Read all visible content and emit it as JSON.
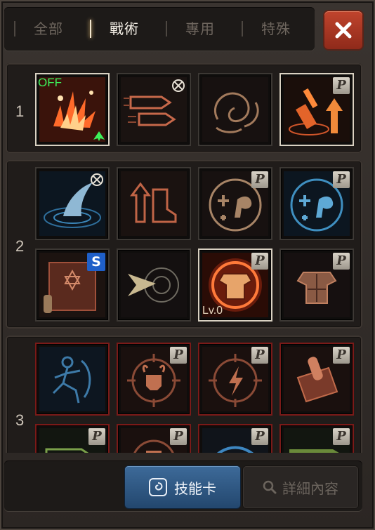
{
  "tabs": [
    {
      "label": "全部",
      "active": false
    },
    {
      "label": "戰術",
      "active": true
    },
    {
      "label": "專用",
      "active": false
    },
    {
      "label": "特殊",
      "active": false
    }
  ],
  "close_icon": "close-x-icon",
  "rows": [
    {
      "number": "1",
      "slots": [
        {
          "icon": "explosion-skill-icon",
          "overlay": "OFF",
          "badge": "upgrade-arrow",
          "selected": true
        },
        {
          "icon": "bullets-skill-icon",
          "badge": "locked"
        },
        {
          "icon": "smoke-swirl-skill-icon"
        },
        {
          "icon": "boost-flask-skill-icon",
          "badge": "P"
        }
      ]
    },
    {
      "number": "2",
      "slots": [
        {
          "icon": "shark-fin-skill-icon",
          "badge": "locked"
        },
        {
          "icon": "boot-up-skill-icon"
        },
        {
          "icon": "strength-plus-skill-icon",
          "badge": "P"
        },
        {
          "icon": "strength-plus-blue-skill-icon",
          "badge": "P"
        },
        {
          "icon": "hexagram-scroll-skill-icon",
          "badge": "S"
        },
        {
          "icon": "dash-crosshair-skill-icon"
        },
        {
          "icon": "armor-fire-skill-icon",
          "badge": "P",
          "level": "Lv.0",
          "selected": true
        },
        {
          "icon": "armor-skill-icon",
          "badge": "P"
        }
      ]
    },
    {
      "number": "3",
      "slots": [
        {
          "icon": "runner-blue-skill-icon"
        },
        {
          "icon": "horned-skull-target-skill-icon",
          "badge": "P"
        },
        {
          "icon": "lightning-target-skill-icon",
          "badge": "P"
        },
        {
          "icon": "ammo-box-skill-icon",
          "badge": "P"
        },
        {
          "icon": "bullet-green-skill-icon",
          "badge": "P"
        },
        {
          "icon": "skull-partial-skill-icon",
          "badge": "P"
        },
        {
          "icon": "blue-arc-skill-icon",
          "badge": "P"
        },
        {
          "icon": "green-rifle-skill-icon",
          "badge": "P"
        }
      ]
    }
  ],
  "bottom": {
    "skill_card_label": "技能卡",
    "skill_card_icon": "skill-card-swirl-icon",
    "detail_label": "詳細內容",
    "detail_icon": "search-icon"
  },
  "colors": {
    "accent_blue": "#2f5d8e",
    "close_red": "#b43c27",
    "off_green": "#3df05a",
    "s_badge_blue": "#1f5fc8",
    "row3_border": "#7a1a18"
  }
}
